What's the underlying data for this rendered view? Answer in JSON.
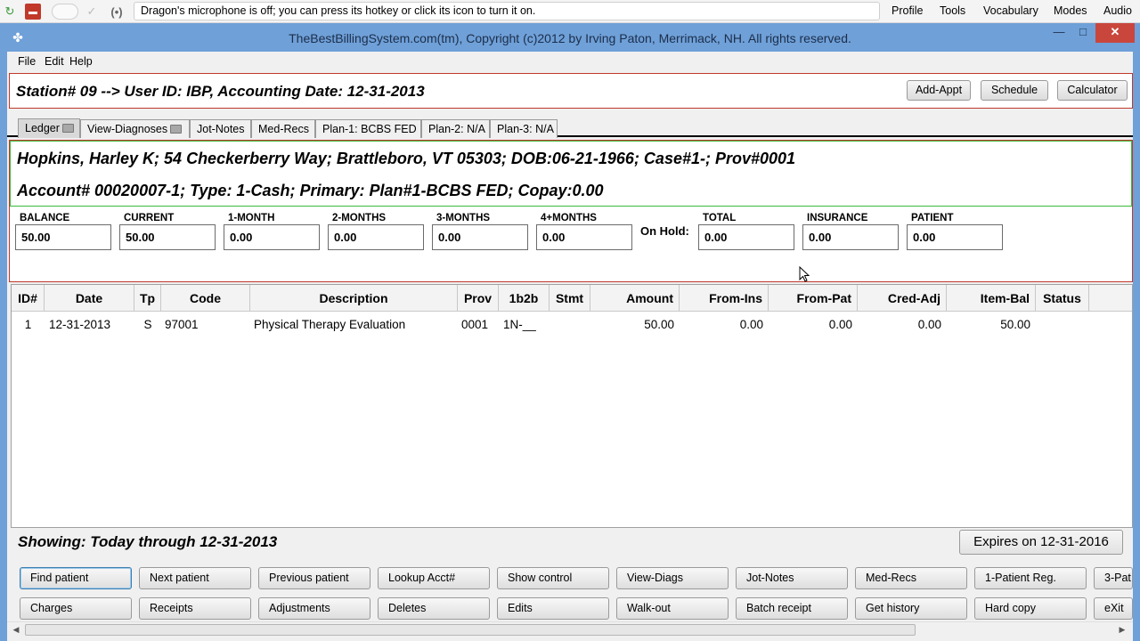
{
  "dragon": {
    "message": "Dragon's microphone is off; you can press its hotkey or click its icon to turn it on.",
    "menu": [
      "Profile",
      "Tools",
      "Vocabulary",
      "Modes",
      "Audio"
    ]
  },
  "window": {
    "title": "TheBestBillingSystem.com(tm), Copyright (c)2012 by Irving Paton, Merrimack, NH. All rights reserved.",
    "minimize": "—",
    "maximize": "□",
    "close": "✕"
  },
  "menubar": [
    "File",
    "Edit",
    "Help"
  ],
  "station": {
    "text": "Station# 09 --> User ID: IBP, Accounting Date: 12-31-2013",
    "buttons": [
      "Add-Appt",
      "Schedule",
      "Calculator"
    ]
  },
  "tabs": [
    "Ledger",
    "View-Diagnoses",
    "Jot-Notes",
    "Med-Recs",
    "Plan-1: BCBS FED",
    "Plan-2: N/A",
    "Plan-3: N/A"
  ],
  "patient": {
    "line1": "Hopkins, Harley K; 54 Checkerberry Way; Brattleboro, VT 05303; DOB:06-21-1966; Case#1-; Prov#0001",
    "line2": "Account# 00020007-1; Type: 1-Cash; Primary: Plan#1-BCBS FED; Copay:0.00",
    "on_hold_label": "On Hold:",
    "balances": [
      {
        "label": "BALANCE",
        "value": "50.00"
      },
      {
        "label": "CURRENT",
        "value": "50.00"
      },
      {
        "label": "1-MONTH",
        "value": "0.00"
      },
      {
        "label": "2-MONTHS",
        "value": "0.00"
      },
      {
        "label": "3-MONTHS",
        "value": "0.00"
      },
      {
        "label": "4+MONTHS",
        "value": "0.00"
      },
      {
        "label": "TOTAL",
        "value": "0.00"
      },
      {
        "label": "INSURANCE",
        "value": "0.00"
      },
      {
        "label": "PATIENT",
        "value": "0.00"
      }
    ]
  },
  "ledger": {
    "columns": [
      "ID#",
      "Date",
      "Tp",
      "Code",
      "Description",
      "Prov",
      "1b2b",
      "Stmt",
      "Amount",
      "From-Ins",
      "From-Pat",
      "Cred-Adj",
      "Item-Bal",
      "Status"
    ],
    "rows": [
      [
        "1",
        "12-31-2013",
        "S",
        "97001",
        "Physical Therapy Evaluation",
        "0001",
        "1N-__",
        "",
        "50.00",
        "0.00",
        "0.00",
        "0.00",
        "50.00",
        ""
      ]
    ]
  },
  "showing": "Showing: Today through 12-31-2013",
  "expires": "Expires on 12-31-2016",
  "actions": {
    "row1": [
      "Find patient",
      "Next patient",
      "Previous patient",
      "Lookup Acct#",
      "Show control",
      "View-Diags",
      "Jot-Notes",
      "Med-Recs",
      "1-Patient Reg.",
      "3-Pat"
    ],
    "row2": [
      "Charges",
      "Receipts",
      "Adjustments",
      "Deletes",
      "Edits",
      "Walk-out",
      "Batch receipt",
      "Get history",
      "Hard copy",
      "eXit"
    ]
  }
}
